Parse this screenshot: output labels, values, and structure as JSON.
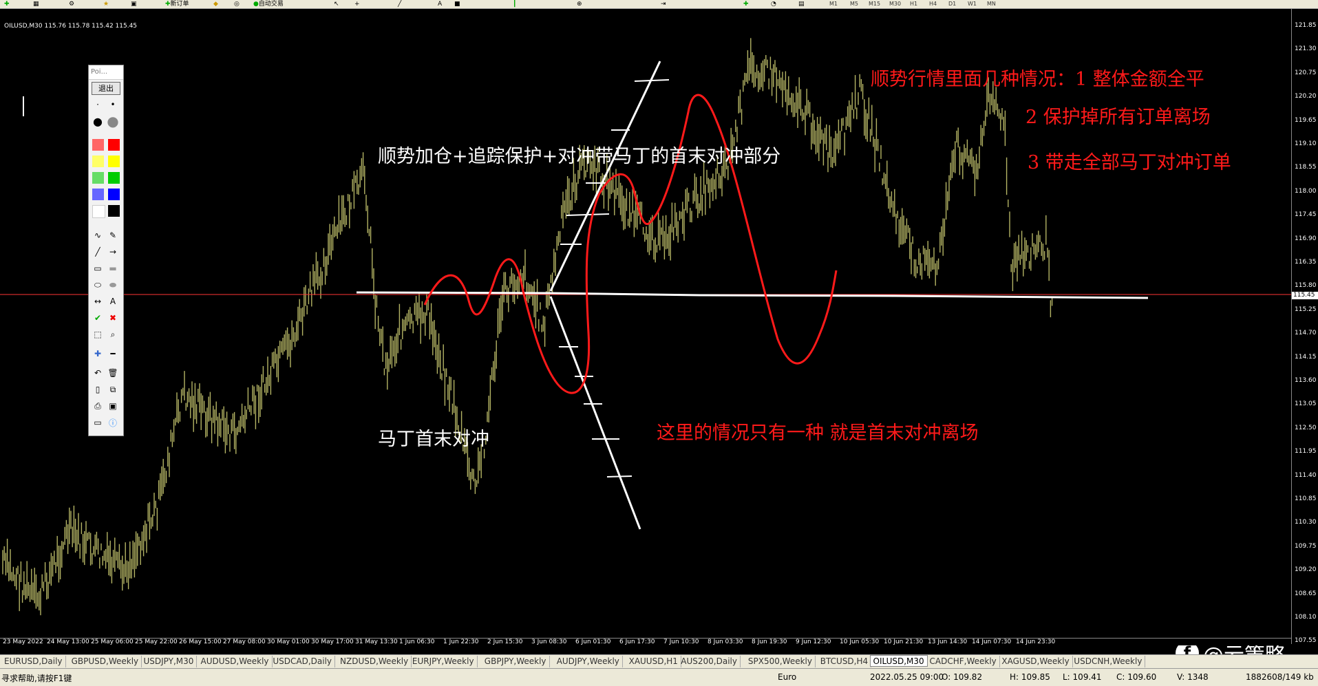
{
  "toolbar": {
    "new_order": "新订单",
    "auto_trading": "自动交易",
    "timeframes": [
      "M1",
      "M5",
      "M15",
      "M30",
      "H1",
      "H4",
      "D1",
      "W1",
      "MN"
    ]
  },
  "chart": {
    "symbol_info": "OILUSD,M30  115.76 115.78 115.42 115.45",
    "current_price": "115.45",
    "price_labels": [
      "121.85",
      "121.30",
      "120.75",
      "120.20",
      "119.65",
      "119.10",
      "118.55",
      "118.00",
      "117.45",
      "116.90",
      "116.35",
      "115.80",
      "115.25",
      "114.70",
      "114.15",
      "113.60",
      "113.05",
      "112.50",
      "111.95",
      "111.40",
      "110.85",
      "110.30",
      "109.75",
      "109.20",
      "108.65",
      "108.10",
      "107.55"
    ],
    "time_labels": [
      "23 May 2022",
      "24 May 13:00",
      "25 May 06:00",
      "25 May 22:00",
      "26 May 15:00",
      "27 May 08:00",
      "30 May 01:00",
      "30 May 17:00",
      "31 May 13:30",
      "1 Jun 06:30",
      "1 Jun 22:30",
      "2 Jun 15:30",
      "3 Jun 08:30",
      "6 Jun 01:30",
      "6 Jun 17:30",
      "7 Jun 10:30",
      "8 Jun 03:30",
      "8 Jun 19:30",
      "9 Jun 12:30",
      "10 Jun 05:30",
      "10 Jun 21:30",
      "13 Jun 14:30",
      "14 Jun 07:30",
      "14 Jun 23:30"
    ],
    "colors": {
      "bars": "#b5b565",
      "annotation_red": "#ff1a1a",
      "annotation_white": "#ffffff",
      "price_line": "#ff3333"
    }
  },
  "annotations": {
    "white_top": "顺势加仓+追踪保护+对冲带马丁的首末对冲部分",
    "white_bottom": "马丁首末对冲",
    "red_top_1": "顺势行情里面几种情况：1  整体金额全平",
    "red_top_2": "2  保护掉所有订单离场",
    "red_top_3": "3   带走全部马丁对冲订单",
    "red_middle": "这里的情况只有一种    就是首末对冲离场"
  },
  "palette": {
    "title": "Poi...",
    "exit": "退出"
  },
  "tabs": [
    "EURUSD,Daily",
    "GBPUSD,Weekly",
    "USDJPY,M30",
    "AUDUSD,Weekly",
    "USDCAD,Daily",
    "NZDUSD,Weekly",
    "EURJPY,Weekly",
    "GBPJPY,Weekly",
    "AUDJPY,Weekly",
    "XAUUSD,H1",
    "AUS200,Daily",
    "SPX500,Weekly",
    "BTCUSD,H4",
    "OILUSD,M30",
    "CADCHF,Weekly",
    "XAGUSD,Weekly",
    "USDCNH,Weekly"
  ],
  "active_tab": "OILUSD,M30",
  "status": {
    "help": "寻求帮助,请按F1键",
    "profile": "Euro",
    "datetime": "2022.05.25 09:00",
    "open": "O: 109.82",
    "high": "H: 109.85",
    "low": "L: 109.41",
    "close": "C: 109.60",
    "volume": "V: 1348",
    "traffic": "1882608/149 kb"
  },
  "watermark": {
    "text": "@云策略",
    "logo": "f"
  }
}
